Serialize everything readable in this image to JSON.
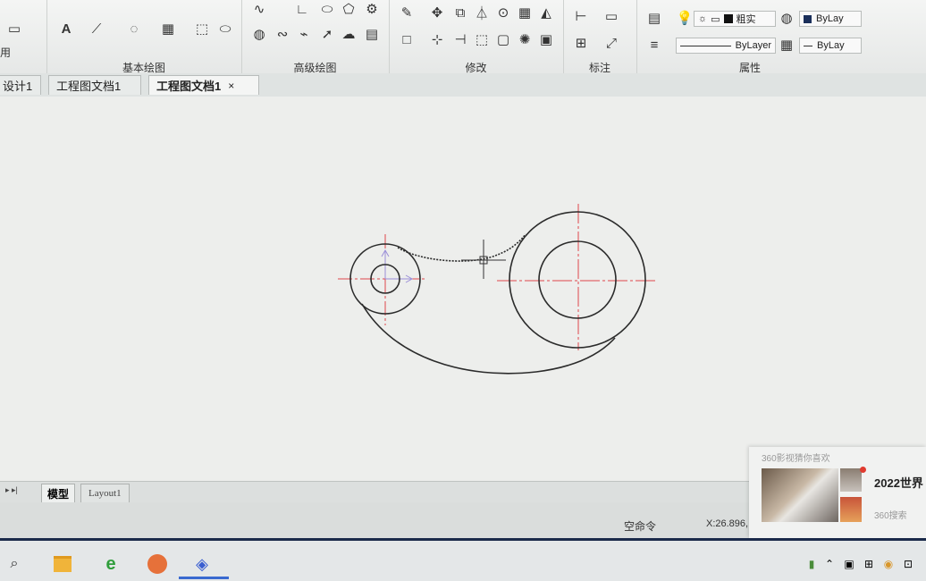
{
  "ribbon": {
    "left_partial_label": "用",
    "groups": {
      "draw": {
        "title": "基本绘图"
      },
      "advanced_draw": {
        "title": "高级绘图"
      },
      "modify": {
        "title": "修改"
      },
      "annotate": {
        "title": "标注"
      },
      "properties": {
        "title": "属性"
      }
    },
    "properties": {
      "linetype_value": "粗实",
      "color_value": "ByLay",
      "lineweight_value": "ByLayer",
      "plotstyle_value": "ByLay"
    }
  },
  "tabs": [
    {
      "label": "设计1"
    },
    {
      "label": "工程图文档1"
    },
    {
      "label": "工程图文档1",
      "close": "×"
    }
  ],
  "layout_tabs": [
    {
      "label": "模型"
    },
    {
      "label": "Layout1"
    }
  ],
  "status": {
    "command": "空命令",
    "coords": "X:26.896,"
  },
  "popup": {
    "header": "360影视猜你喜欢",
    "title": "2022世界",
    "sub": "360搜索"
  },
  "colors": {
    "center_line": "#e0474c",
    "outline": "#2b2b2b",
    "canvas": "#edeeec",
    "taskbar_top": "#1b2a4a"
  },
  "taskbar": {
    "icons": [
      "search-icon",
      "folder-icon",
      "ie-icon",
      "speaker-app-icon",
      "cad-app-icon"
    ]
  }
}
